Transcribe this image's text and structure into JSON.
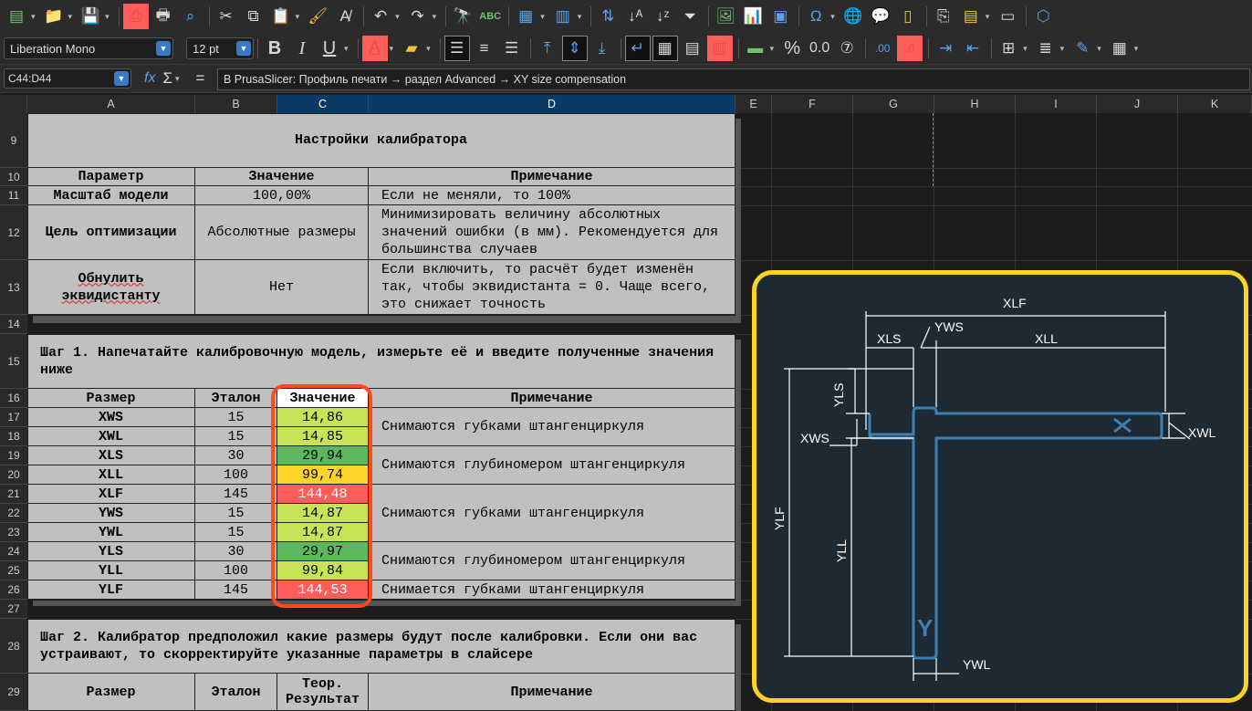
{
  "toolbar": {
    "font_name": "Liberation Mono",
    "font_size": "12 pt",
    "buttons_row1": [
      "new-document",
      "open",
      "save",
      "export-pdf",
      "print",
      "print-preview",
      "cut",
      "copy",
      "paste",
      "clone-formatting",
      "clear-formatting",
      "undo",
      "redo",
      "find-replace",
      "spelling",
      "row",
      "column",
      "sort-ascending",
      "sort-az",
      "sort-za",
      "autofilter",
      "insert-image",
      "insert-chart",
      "pivot-table",
      "special-character",
      "hyperlink",
      "comment",
      "header-footer",
      "define-print-area",
      "freeze",
      "split",
      "show-draw"
    ],
    "bold": "B",
    "italic": "I",
    "underline": "U",
    "percent": "%",
    "zero_decimals": "0.0"
  },
  "formula_bar": {
    "cell_ref": "C44:D44",
    "fx": "fx",
    "sigma": "Σ",
    "equals": "=",
    "content": "В PrusaSlicer: Профиль печати → раздел Advanced → XY size compensation"
  },
  "columns": [
    "A",
    "B",
    "C",
    "D",
    "E",
    "F",
    "G",
    "H",
    "I",
    "J",
    "K"
  ],
  "rows": [
    "9",
    "10",
    "11",
    "12",
    "13",
    "14",
    "15",
    "16",
    "17",
    "18",
    "19",
    "20",
    "21",
    "22",
    "23",
    "24",
    "25",
    "26",
    "27",
    "28",
    "29"
  ],
  "settings": {
    "title": "Настройки калибратора",
    "headers": [
      "Параметр",
      "Значение",
      "Примечание"
    ],
    "rows": [
      {
        "param": "Масштаб модели",
        "value": "100,00%",
        "note": "Если не меняли, то 100%"
      },
      {
        "param": "Цель оптимизации",
        "value": "Абсолютные размеры",
        "note": "Минимизировать величину абсолютных значений ошибки (в мм). Рекомендуется для большинства случаев"
      },
      {
        "param": "Обнулить эквидистанту",
        "value": "Нет",
        "note": "Если включить, то расчёт будет изменён так, чтобы эквидистанта = 0. Чаще всего, это снижает точность"
      }
    ]
  },
  "step1": {
    "title": "Шаг 1. Напечатайте калибровочную модель, измерьте её и введите полученные значения ниже",
    "headers": [
      "Размер",
      "Эталон",
      "Значение",
      "Примечание"
    ],
    "rows": [
      {
        "size": "XWS",
        "ref": "15",
        "value": "14,86",
        "color": "#c9e356"
      },
      {
        "size": "XWL",
        "ref": "15",
        "value": "14,85",
        "color": "#c9e356"
      },
      {
        "size": "XLS",
        "ref": "30",
        "value": "29,94",
        "color": "#5cb85c"
      },
      {
        "size": "XLL",
        "ref": "100",
        "value": "99,74",
        "color": "#ffd42a"
      },
      {
        "size": "XLF",
        "ref": "145",
        "value": "144,48",
        "color": "#ff5c5c"
      },
      {
        "size": "YWS",
        "ref": "15",
        "value": "14,87",
        "color": "#c9e356"
      },
      {
        "size": "YWL",
        "ref": "15",
        "value": "14,87",
        "color": "#c9e356"
      },
      {
        "size": "YLS",
        "ref": "30",
        "value": "29,97",
        "color": "#5cb85c"
      },
      {
        "size": "YLL",
        "ref": "100",
        "value": "99,84",
        "color": "#c9e356"
      },
      {
        "size": "YLF",
        "ref": "145",
        "value": "144,53",
        "color": "#ff5c5c"
      }
    ],
    "notes": [
      "Снимаются губками штангенциркуля",
      "Снимаются глубиномером штангенциркуля",
      "Снимаются губками штангенциркуля",
      "Снимаются глубиномером штангенциркуля",
      "Снимается губками штангенциркуля"
    ]
  },
  "step2": {
    "title": "Шаг 2. Калибратор предположил какие размеры будут после калибровки. Если они вас устраивают, то скорректируйте указанные параметры в слайсере",
    "headers": [
      "Размер",
      "Эталон",
      "Теор. Результат",
      "Примечание"
    ]
  },
  "diagram": {
    "labels": [
      "XLF",
      "YWS",
      "XLS",
      "XLL",
      "YLS",
      "XWS",
      "XWL",
      "YLF",
      "YLL",
      "YWL",
      "Y"
    ],
    "border_color": "#ffd21f",
    "line_color": "#3d7fb0"
  }
}
